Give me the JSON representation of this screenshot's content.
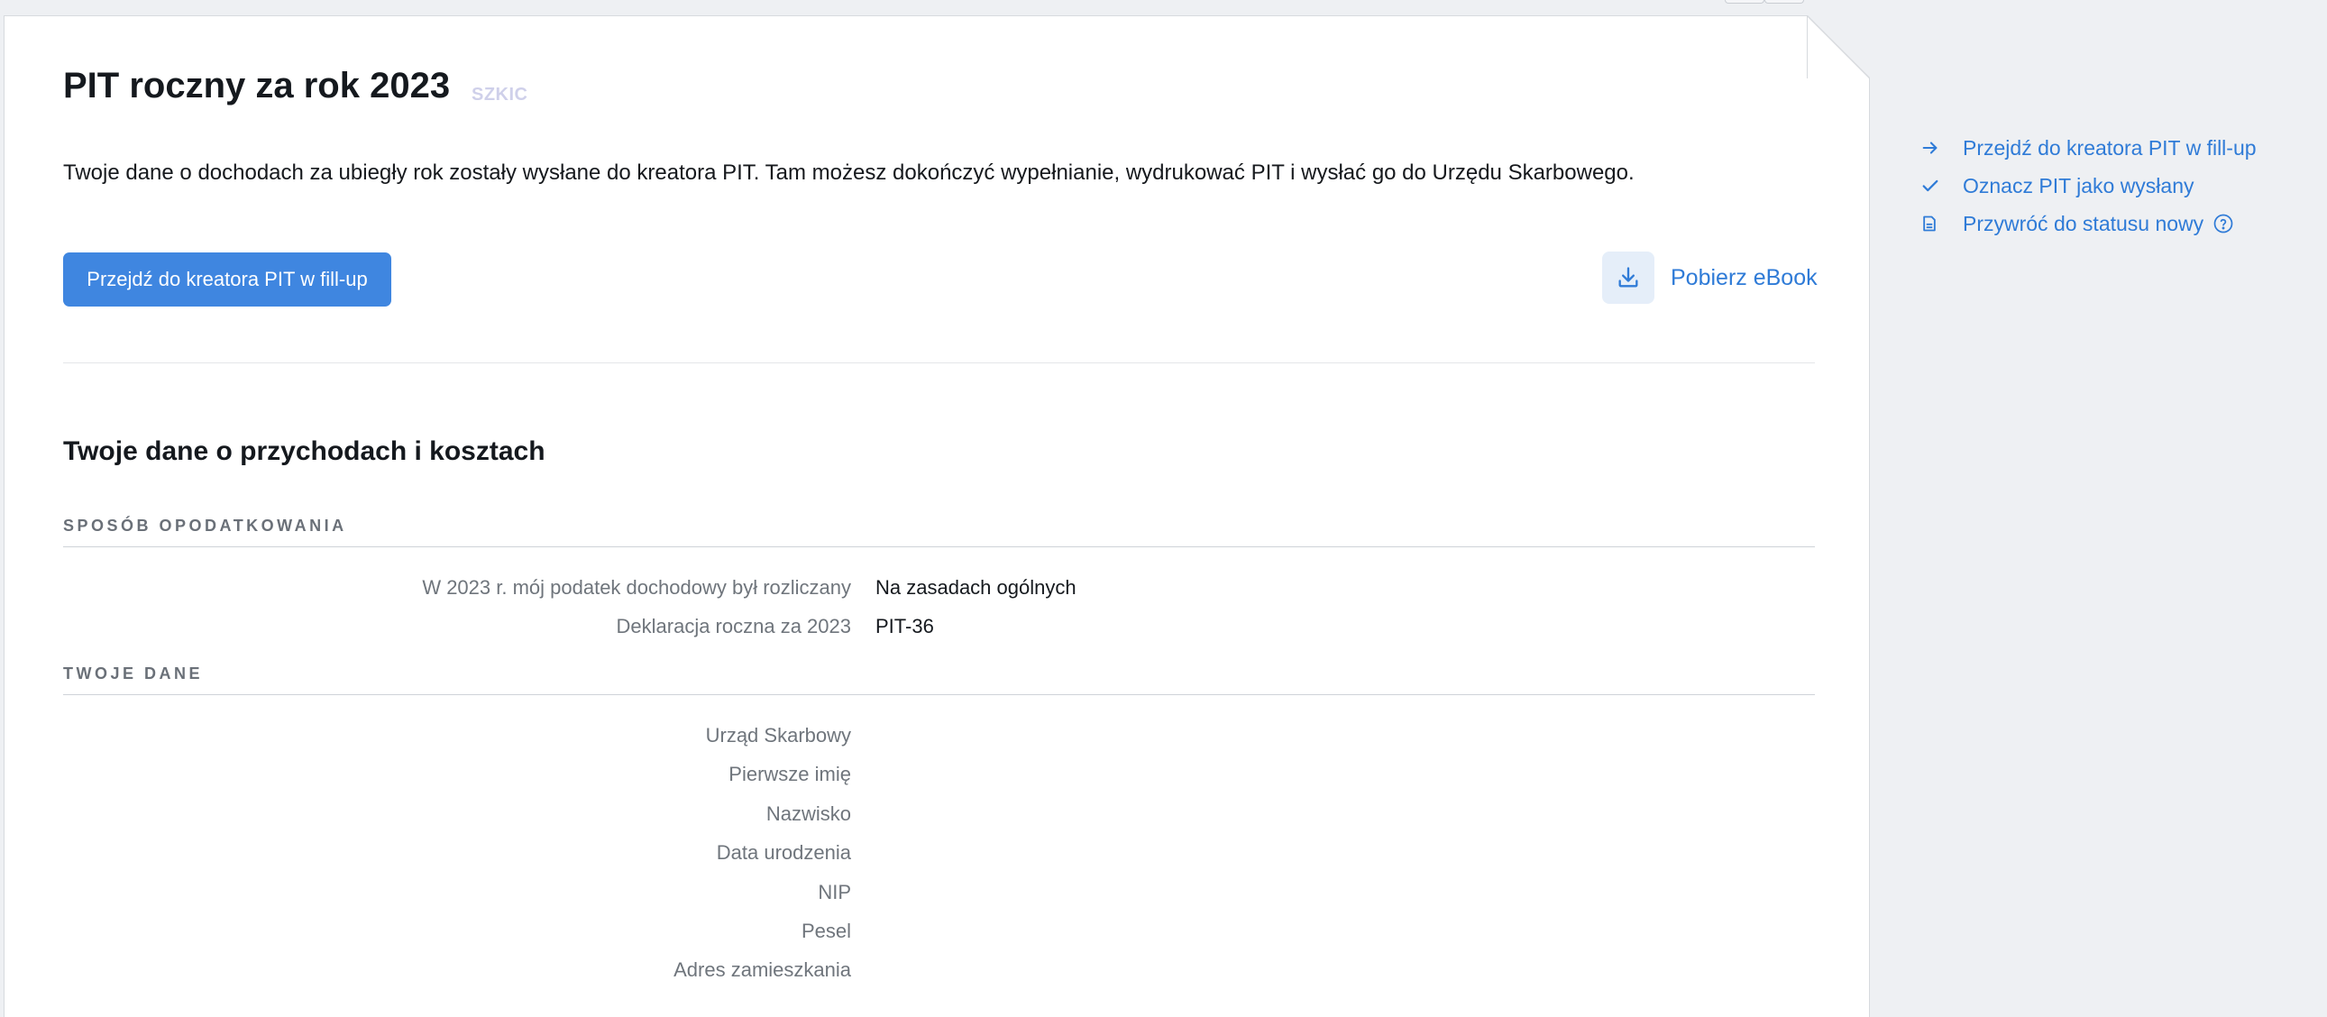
{
  "header": {
    "title": "PIT roczny za rok 2023",
    "status_badge": "SZKIC"
  },
  "intro_text": "Twoje dane o dochodach za ubiegły rok zostały wysłane do kreatora PIT. Tam możesz dokończyć wypełnianie, wydrukować PIT i wysłać go do Urzędu Skarbowego.",
  "actions": {
    "primary_button": "Przejdź do kreatora PIT w fill-up",
    "ebook_link": "Pobierz eBook",
    "ebook_icon": "download-icon"
  },
  "data_section": {
    "title": "Twoje dane o przychodach i kosztach",
    "taxation": {
      "heading": "SPOSÓB OPODATKOWANIA",
      "rows": [
        {
          "label": "W 2023 r. mój podatek dochodowy był rozliczany",
          "value": "Na zasadach ogólnych"
        },
        {
          "label": "Deklaracja roczna za 2023",
          "value": "PIT-36"
        }
      ]
    },
    "personal": {
      "heading": "TWOJE DANE",
      "rows": [
        {
          "label": "Urząd Skarbowy",
          "value": ""
        },
        {
          "label": "Pierwsze imię",
          "value": ""
        },
        {
          "label": "Nazwisko",
          "value": ""
        },
        {
          "label": "Data urodzenia",
          "value": ""
        },
        {
          "label": "NIP",
          "value": ""
        },
        {
          "label": "Pesel",
          "value": ""
        },
        {
          "label": "Adres zamieszkania",
          "value": ""
        }
      ]
    }
  },
  "sidebar": {
    "items": [
      {
        "label": "Przejdź do kreatora PIT w fill-up",
        "icon": "arrow-right-icon"
      },
      {
        "label": "Oznacz PIT jako wysłany",
        "icon": "check-icon"
      },
      {
        "label": "Przywróć do statusu nowy",
        "icon": "document-icon",
        "help_icon": "help-circle-icon"
      }
    ]
  },
  "colors": {
    "accent": "#3f86e0",
    "link": "#2f7bd7",
    "page_background": "#eef0f3",
    "card_background": "#ffffff",
    "badge": "#cfd0ea",
    "label_gray": "#6f757c"
  }
}
